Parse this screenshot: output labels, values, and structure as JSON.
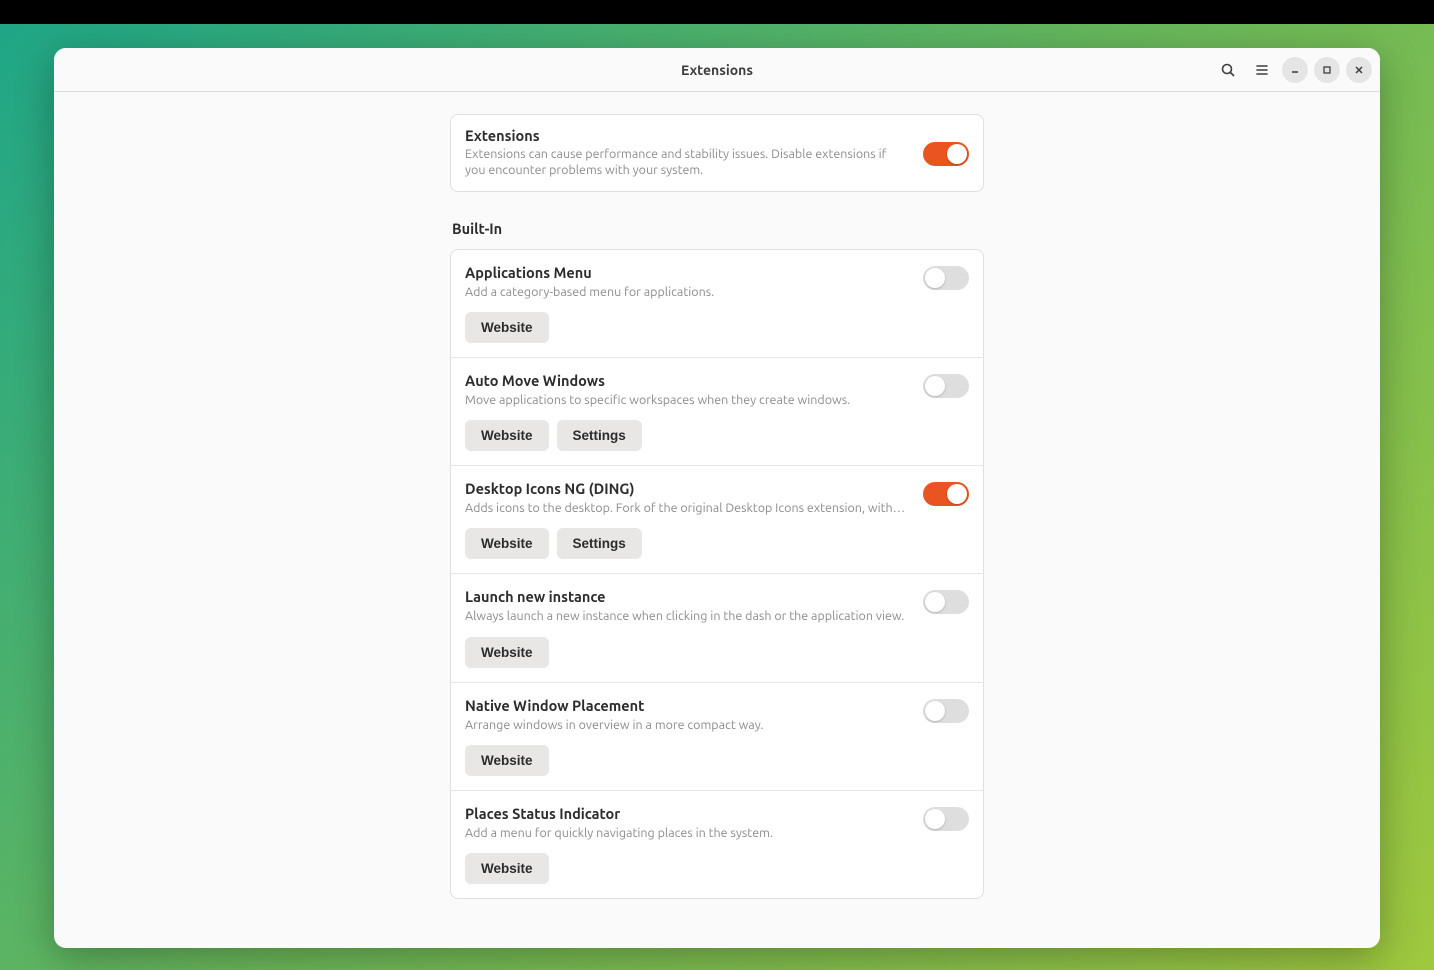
{
  "colors": {
    "accent": "#e95420"
  },
  "header": {
    "title": "Extensions"
  },
  "global": {
    "title": "Extensions",
    "desc": "Extensions can cause performance and stability issues. Disable extensions if you encounter problems with your system.",
    "enabled": true
  },
  "section_label": "Built-In",
  "labels": {
    "website": "Website",
    "settings": "Settings"
  },
  "extensions": [
    {
      "name": "Applications Menu",
      "desc": "Add a category-based menu for applications.",
      "enabled": false,
      "has_settings": false
    },
    {
      "name": "Auto Move Windows",
      "desc": "Move applications to specific workspaces when they create windows.",
      "enabled": false,
      "has_settings": true
    },
    {
      "name": "Desktop Icons NG (DING)",
      "desc": "Adds icons to the desktop. Fork of the original Desktop Icons extension, with several enh…",
      "enabled": true,
      "has_settings": true
    },
    {
      "name": "Launch new instance",
      "desc": "Always launch a new instance when clicking in the dash or the application view.",
      "enabled": false,
      "has_settings": false
    },
    {
      "name": "Native Window Placement",
      "desc": "Arrange windows in overview in a more compact way.",
      "enabled": false,
      "has_settings": false
    },
    {
      "name": "Places Status Indicator",
      "desc": "Add a menu for quickly navigating places in the system.",
      "enabled": false,
      "has_settings": false
    }
  ]
}
